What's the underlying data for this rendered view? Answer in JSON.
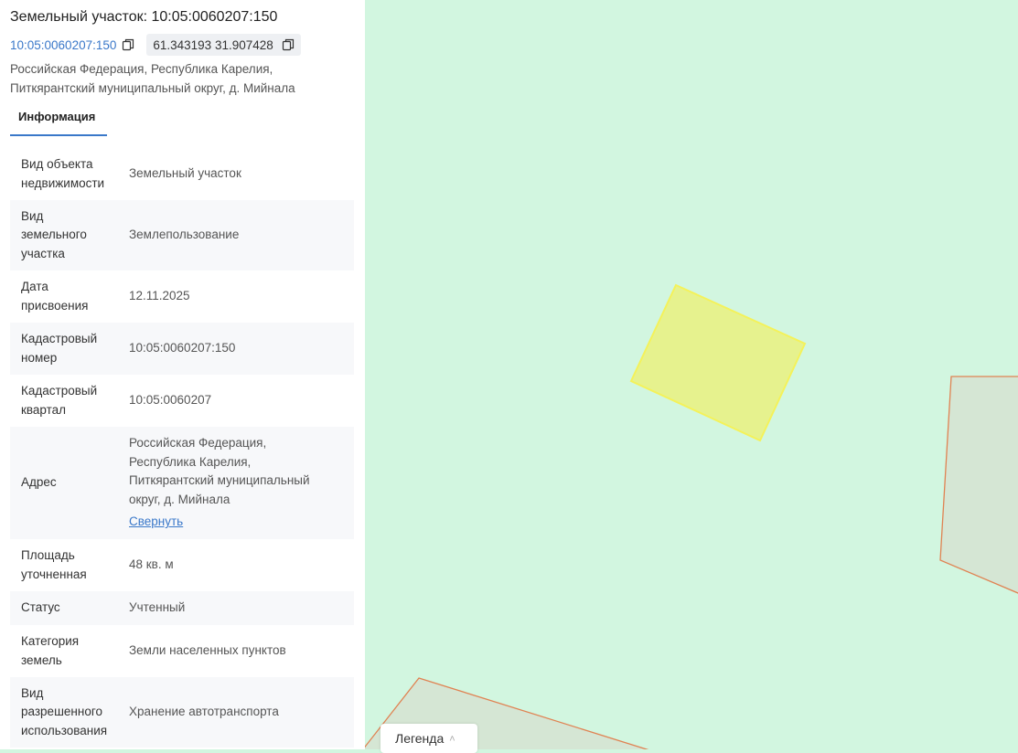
{
  "panel": {
    "title": "Земельный участок: 10:05:0060207:150",
    "cadastral_link": "10:05:0060207:150",
    "coordinates": "61.343193 31.907428",
    "address_lines": [
      "Российская Федерация, Республика Карелия,",
      "Питкярантский муниципальный округ, д. Мийнала"
    ],
    "tab_label": "Информация",
    "rows": [
      {
        "key_lines": [
          "Вид объекта",
          "недвижимости"
        ],
        "value": "Земельный участок"
      },
      {
        "key_lines": [
          "Вид",
          "земельного",
          "участка"
        ],
        "value": "Землепользование"
      },
      {
        "key_lines": [
          "Дата",
          "присвоения"
        ],
        "value": "12.11.2025"
      },
      {
        "key_lines": [
          "Кадастровый",
          "номер"
        ],
        "value": "10:05:0060207:150"
      },
      {
        "key_lines": [
          "Кадастровый",
          "квартал"
        ],
        "value": "10:05:0060207"
      },
      {
        "key_lines": [
          "Адрес"
        ],
        "value_lines": [
          "Российская Федерация,",
          "Республика Карелия,",
          "Питкярантский муниципальный",
          "округ, д. Мийнала"
        ],
        "link": "Свернуть"
      },
      {
        "key_lines": [
          "Площадь",
          "уточненная"
        ],
        "value": "48 кв. м"
      },
      {
        "key_lines": [
          "Статус"
        ],
        "value": "Учтенный"
      },
      {
        "key_lines": [
          "Категория",
          "земель"
        ],
        "value": "Земли населенных пунктов"
      },
      {
        "key_lines": [
          "Вид",
          "разрешенного",
          "использования"
        ],
        "value": "Хранение автотранспорта"
      }
    ]
  },
  "map": {
    "legend_label": "Легенда",
    "colors": {
      "background": "#d2f6e0",
      "selected_fill": "#e6f28e",
      "selected_stroke": "#f4f25a",
      "parcel_fill": "#d5e6d4",
      "parcel_stroke": "#e08252",
      "accent": "#3a78c9"
    }
  }
}
